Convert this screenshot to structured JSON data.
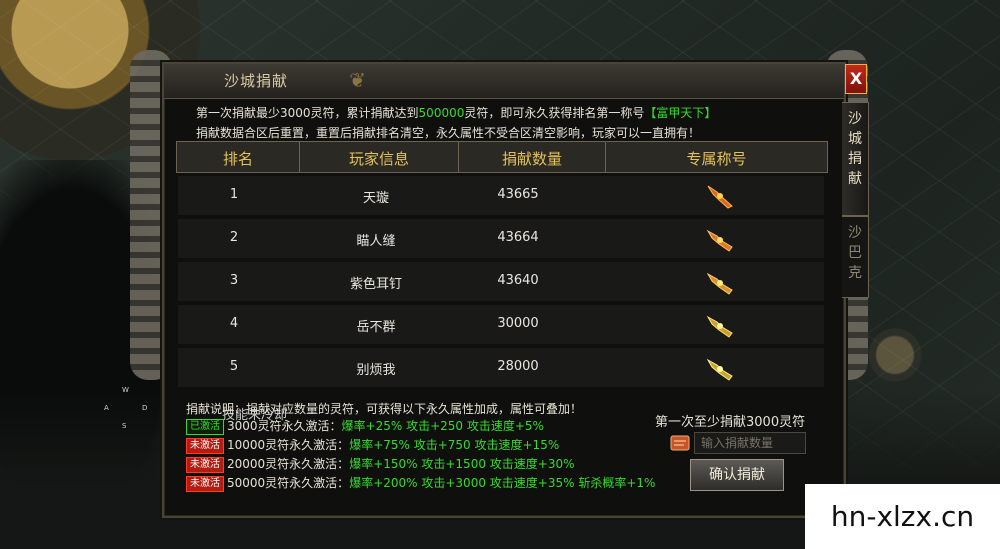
{
  "minimap": {
    "n": "W",
    "w": "A",
    "e": "D",
    "s": "S"
  },
  "hud": {
    "cooldown_text": "技能未冷却"
  },
  "panel": {
    "title": "沙城捐献",
    "close_label": "X",
    "tabs": [
      {
        "label": "沙城捐献",
        "active": true
      },
      {
        "label": "沙巴克",
        "active": false
      }
    ],
    "intro": {
      "line1_a": "第一次捐献最少3000灵符，累计捐献达到",
      "line1_amount": "500000",
      "line1_b": "灵符，即可永久获得排名第一称号",
      "line1_title": "【富甲天下】",
      "line2": "捐献数据合区后重置，重置后捐献排名清空，永久属性不受合区清空影响，玩家可以一直拥有！"
    },
    "table": {
      "headers": [
        "排名",
        "玩家信息",
        "捐献数量",
        "专属称号"
      ],
      "rows": [
        {
          "rank": "1",
          "player": "天璇",
          "amount": "43665",
          "badge": "rank-1-title-icon"
        },
        {
          "rank": "2",
          "player": "瞄人缝",
          "amount": "43664",
          "badge": "rank-2-title-icon"
        },
        {
          "rank": "3",
          "player": "紫色耳钉",
          "amount": "43640",
          "badge": "rank-3-title-icon"
        },
        {
          "rank": "4",
          "player": "岳不群",
          "amount": "30000",
          "badge": "rank-4-title-icon"
        },
        {
          "rank": "5",
          "player": "别烦我",
          "amount": "28000",
          "badge": "rank-5-title-icon"
        }
      ]
    },
    "description": "捐献说明：捐献对应数量的灵符，可获得以下永久属性加成，属性可叠加！",
    "activations": [
      {
        "status": "已激活",
        "active": true,
        "cond": "3000灵符永久激活：",
        "attrs": "爆率+25% 攻击+250 攻击速度+5%"
      },
      {
        "status": "未激活",
        "active": false,
        "cond": "10000灵符永久激活：",
        "attrs": "爆率+75% 攻击+750 攻击速度+15%"
      },
      {
        "status": "未激活",
        "active": false,
        "cond": "20000灵符永久激活：",
        "attrs": "爆率+150% 攻击+1500 攻击速度+30%"
      },
      {
        "status": "未激活",
        "active": false,
        "cond": "50000灵符永久激活：",
        "attrs": "爆率+200% 攻击+3000 攻击速度+35% 斩杀概率+1%"
      }
    ],
    "donate": {
      "min_text": "第一次至少捐献3000灵符",
      "placeholder": "输入捐献数量",
      "confirm_label": "确认捐献"
    }
  },
  "watermark": "hn-xlzx.cn",
  "colors": {
    "accent_green": "#35dc2a",
    "header_gold": "#e4c259",
    "inactive_red": "#b51c10",
    "close_red": "#c42a1b"
  }
}
